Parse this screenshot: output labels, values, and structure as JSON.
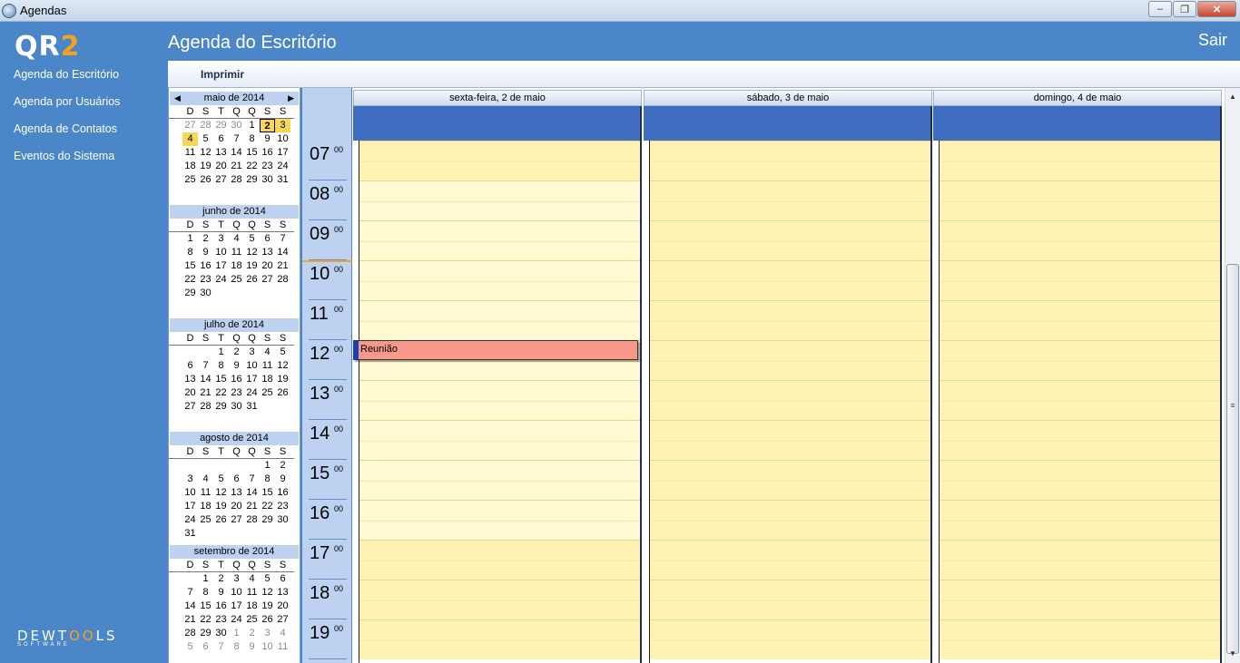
{
  "window": {
    "title": "Agendas",
    "minimize": "–",
    "maximize": "❐",
    "close": "✕"
  },
  "logo": {
    "main": "QR",
    "accent": "2"
  },
  "sidebar": {
    "items": [
      {
        "label": "Agenda do Escritório"
      },
      {
        "label": "Agenda por Usuários"
      },
      {
        "label": "Agenda de Contatos"
      },
      {
        "label": "Eventos do Sistema"
      }
    ],
    "footer": {
      "brand_a": "DEWT",
      "brand_b": "OO",
      "brand_c": "LS",
      "sub": "SOFTWARE"
    }
  },
  "header": {
    "title": "Agenda do Escritório",
    "logout": "Sair"
  },
  "toolbar": {
    "print": "Imprimir"
  },
  "calendar": {
    "prev": "◀",
    "next": "▶",
    "dow": [
      "D",
      "S",
      "T",
      "Q",
      "Q",
      "S",
      "S"
    ],
    "months": [
      {
        "title": "maio de 2014",
        "weeks": [
          [
            "27",
            "28",
            "29",
            "30",
            "1",
            "2",
            "3"
          ],
          [
            "4",
            "5",
            "6",
            "7",
            "8",
            "9",
            "10"
          ],
          [
            "11",
            "12",
            "13",
            "14",
            "15",
            "16",
            "17"
          ],
          [
            "18",
            "19",
            "20",
            "21",
            "22",
            "23",
            "24"
          ],
          [
            "25",
            "26",
            "27",
            "28",
            "29",
            "30",
            "31"
          ]
        ]
      },
      {
        "title": "junho de 2014",
        "weeks": [
          [
            "1",
            "2",
            "3",
            "4",
            "5",
            "6",
            "7"
          ],
          [
            "8",
            "9",
            "10",
            "11",
            "12",
            "13",
            "14"
          ],
          [
            "15",
            "16",
            "17",
            "18",
            "19",
            "20",
            "21"
          ],
          [
            "22",
            "23",
            "24",
            "25",
            "26",
            "27",
            "28"
          ],
          [
            "29",
            "30",
            "",
            "",
            "",
            "",
            ""
          ]
        ]
      },
      {
        "title": "julho de 2014",
        "weeks": [
          [
            "",
            "",
            "1",
            "2",
            "3",
            "4",
            "5"
          ],
          [
            "6",
            "7",
            "8",
            "9",
            "10",
            "11",
            "12"
          ],
          [
            "13",
            "14",
            "15",
            "16",
            "17",
            "18",
            "19"
          ],
          [
            "20",
            "21",
            "22",
            "23",
            "24",
            "25",
            "26"
          ],
          [
            "27",
            "28",
            "29",
            "30",
            "31",
            "",
            ""
          ]
        ]
      },
      {
        "title": "agosto de 2014",
        "weeks": [
          [
            "",
            "",
            "",
            "",
            "",
            "1",
            "2"
          ],
          [
            "3",
            "4",
            "5",
            "6",
            "7",
            "8",
            "9"
          ],
          [
            "10",
            "11",
            "12",
            "13",
            "14",
            "15",
            "16"
          ],
          [
            "17",
            "18",
            "19",
            "20",
            "21",
            "22",
            "23"
          ],
          [
            "24",
            "25",
            "26",
            "27",
            "28",
            "29",
            "30"
          ],
          [
            "31",
            "",
            "",
            "",
            "",
            "",
            ""
          ]
        ]
      },
      {
        "title": "setembro de 2014",
        "weeks": [
          [
            "",
            "1",
            "2",
            "3",
            "4",
            "5",
            "6"
          ],
          [
            "7",
            "8",
            "9",
            "10",
            "11",
            "12",
            "13"
          ],
          [
            "14",
            "15",
            "16",
            "17",
            "18",
            "19",
            "20"
          ],
          [
            "21",
            "22",
            "23",
            "24",
            "25",
            "26",
            "27"
          ],
          [
            "28",
            "29",
            "30",
            "1",
            "2",
            "3",
            "4"
          ],
          [
            "5",
            "6",
            "7",
            "8",
            "9",
            "10",
            "11"
          ]
        ]
      }
    ],
    "today": "2 de maio de 2014",
    "selected_range": [
      "2 de maio de 2014",
      "3 de maio de 2014",
      "4 de maio de 2014"
    ]
  },
  "scheduler": {
    "days": [
      {
        "header": "sexta-feira, 2 de maio",
        "work_start": 8,
        "work_end": 17
      },
      {
        "header": "sábado, 3 de maio",
        "work_start": null,
        "work_end": null
      },
      {
        "header": "domingo, 4 de maio",
        "work_start": null,
        "work_end": null
      }
    ],
    "hours": [
      {
        "h": "07",
        "m": "00"
      },
      {
        "h": "08",
        "m": "00"
      },
      {
        "h": "09",
        "m": "00"
      },
      {
        "h": "10",
        "m": "00"
      },
      {
        "h": "11",
        "m": "00"
      },
      {
        "h": "12",
        "m": "00"
      },
      {
        "h": "13",
        "m": "00"
      },
      {
        "h": "14",
        "m": "00"
      },
      {
        "h": "15",
        "m": "00"
      },
      {
        "h": "16",
        "m": "00"
      },
      {
        "h": "17",
        "m": "00"
      },
      {
        "h": "18",
        "m": "00"
      },
      {
        "h": "19",
        "m": "00"
      }
    ],
    "current_time": "10:00",
    "appointments": [
      {
        "title": "Reunião",
        "day": 0,
        "start": "12:00",
        "end": "12:30",
        "color": "#f7998a",
        "category_color": "#1a3fb8"
      }
    ],
    "scroll_grip": "≡"
  },
  "colors": {
    "accent": "#4a86c8",
    "allday": "#3e6cc0",
    "work_hours": "#fffad2",
    "off_hours": "#fff2b2",
    "today_highlight": "#f7d65a"
  }
}
